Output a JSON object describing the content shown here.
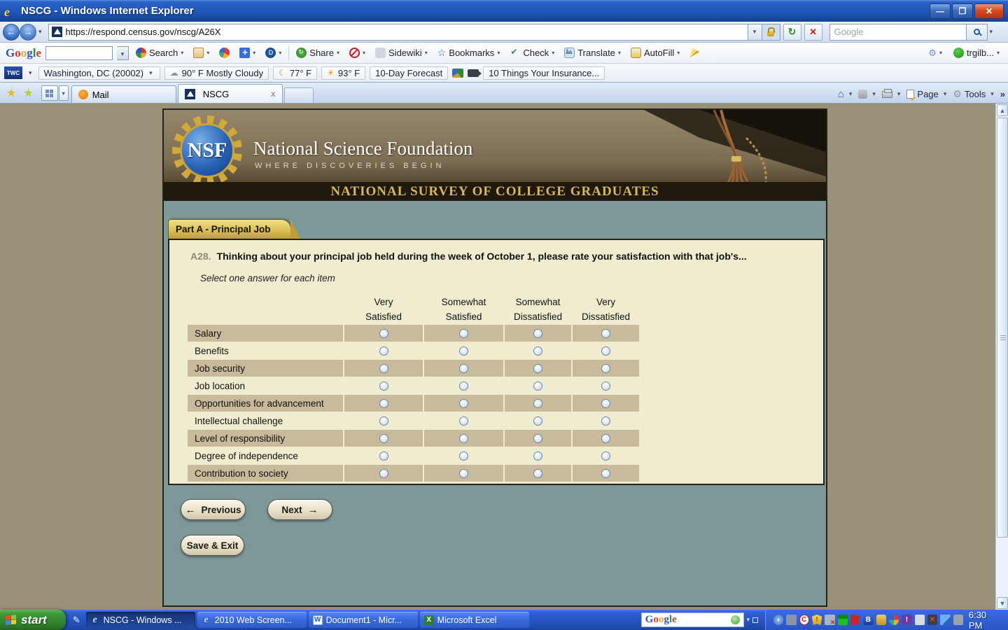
{
  "window": {
    "title": "NSCG - Windows Internet Explorer",
    "url": "https://respond.census.gov/nscg/A26X",
    "search_placeholder": "Google"
  },
  "google_toolbar": {
    "logo_letters": [
      "G",
      "o",
      "o",
      "g",
      "l",
      "e"
    ],
    "search": "Search",
    "share": "Share",
    "sidewiki": "Sidewiki",
    "bookmarks": "Bookmarks",
    "check": "Check",
    "translate": "Translate",
    "autofill": "AutoFill",
    "account": "trgilb..."
  },
  "twc_toolbar": {
    "logo": "TWC",
    "location": "Washington, DC (20002)",
    "conditions": "90° F Mostly Cloudy",
    "temp_low": "77° F",
    "temp_high": "93° F",
    "forecast": "10-Day Forecast",
    "headline": "10 Things Your Insurance..."
  },
  "tabs": {
    "mail": "Mail",
    "nscg": "NSCG",
    "close_glyph": "x"
  },
  "command_bar": {
    "page": "Page",
    "tools": "Tools",
    "overflow_glyph": "»"
  },
  "survey": {
    "org": "National Science Foundation",
    "tagline": "WHERE DISCOVERIES BEGIN",
    "logo_text": "NSF",
    "banner": "NATIONAL SURVEY OF COLLEGE GRADUATES",
    "section_tab": "Part A - Principal Job",
    "question_number": "A28.",
    "question_text": "Thinking about your principal job held during the week of October 1, please rate your satisfaction with that job's...",
    "instruction": "Select one answer for each item",
    "table": {
      "columns": [
        {
          "line1": "Very",
          "line2": "Satisfied"
        },
        {
          "line1": "Somewhat",
          "line2": "Satisfied"
        },
        {
          "line1": "Somewhat",
          "line2": "Dissatisfied"
        },
        {
          "line1": "Very",
          "line2": "Dissatisfied"
        }
      ],
      "rows": [
        "Salary",
        "Benefits",
        "Job security",
        "Job location",
        "Opportunities for advancement",
        "Intellectual challenge",
        "Level of responsibility",
        "Degree of independence",
        "Contribution to society"
      ]
    },
    "buttons": {
      "previous": "Previous",
      "next": "Next",
      "save_exit": "Save & Exit",
      "prev_arrow": "←",
      "next_arrow": "→"
    }
  },
  "taskbar": {
    "start": "start",
    "tasks": [
      {
        "label": "NSCG - Windows ...",
        "app": "ie",
        "active": true
      },
      {
        "label": "2010 Web Screen...",
        "app": "ie",
        "active": false
      },
      {
        "label": "Document1 - Micr...",
        "app": "word",
        "active": false
      },
      {
        "label": "Microsoft Excel",
        "app": "excel",
        "active": false
      }
    ],
    "search_logo": "Google",
    "clock": "6:30 PM"
  },
  "colors": {
    "accent_gold": "#d9b857",
    "panel_teal": "#7e9798",
    "row_tan": "#c8ba9b",
    "panel_cream": "#f0ecd0"
  }
}
